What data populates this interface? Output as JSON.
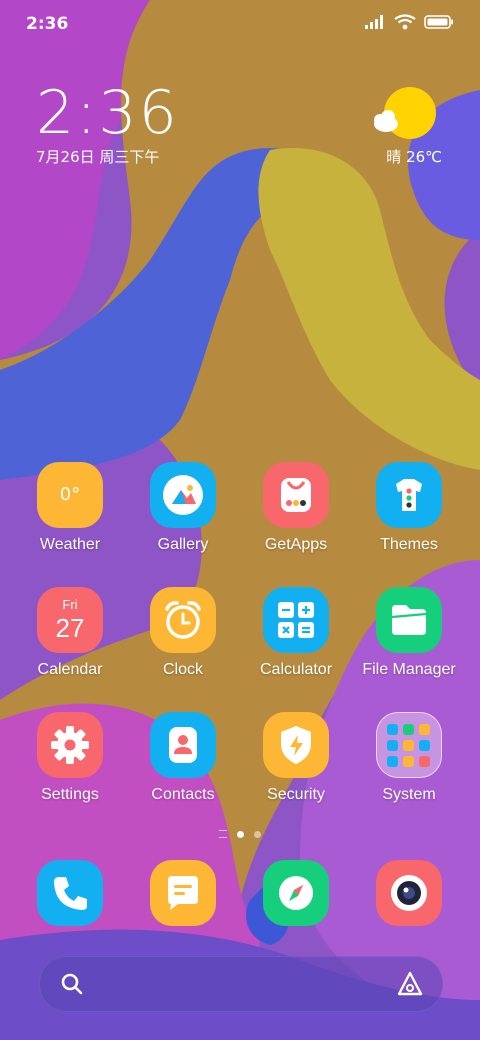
{
  "status_bar": {
    "time": "2:36",
    "icons": [
      "signal-icon",
      "wifi-icon",
      "battery-icon"
    ]
  },
  "widget": {
    "time": "2:36",
    "date": "7月26日 周三下午",
    "weather": "晴 26℃",
    "icon": "sunny-cloud-icon"
  },
  "apps": [
    {
      "label": "Weather",
      "icon": "weather-icon",
      "color": "#FDB734",
      "badge": "0°"
    },
    {
      "label": "Gallery",
      "icon": "gallery-icon",
      "color": "#12B0F0"
    },
    {
      "label": "GetApps",
      "icon": "getapps-icon",
      "color": "#F8676B"
    },
    {
      "label": "Themes",
      "icon": "themes-icon",
      "color": "#12B0F0"
    },
    {
      "label": "Calendar",
      "icon": "calendar-icon",
      "color": "#F8676B",
      "day": "Fri",
      "date": "27"
    },
    {
      "label": "Clock",
      "icon": "clock-icon",
      "color": "#FDB734"
    },
    {
      "label": "Calculator",
      "icon": "calculator-icon",
      "color": "#12B0F0"
    },
    {
      "label": "File Manager",
      "icon": "folder-icon",
      "color": "#16CF7C"
    },
    {
      "label": "Settings",
      "icon": "settings-icon",
      "color": "#F8676B"
    },
    {
      "label": "Contacts",
      "icon": "contacts-icon",
      "color": "#12B0F0"
    },
    {
      "label": "Security",
      "icon": "security-icon",
      "color": "#FDB734"
    },
    {
      "label": "System",
      "icon": "system-folder-icon",
      "color": "rgba(255,255,255,0.35)"
    }
  ],
  "dock": [
    {
      "icon": "phone-icon",
      "color": "#12B0F0"
    },
    {
      "icon": "messages-icon",
      "color": "#FDB734"
    },
    {
      "icon": "browser-icon",
      "color": "#16CF7C"
    },
    {
      "icon": "camera-icon",
      "color": "#F8676B"
    }
  ],
  "pagination": {
    "pages": 2,
    "current": 1
  },
  "search_bar": {
    "icons": [
      "search-icon",
      "assistant-icon"
    ]
  }
}
